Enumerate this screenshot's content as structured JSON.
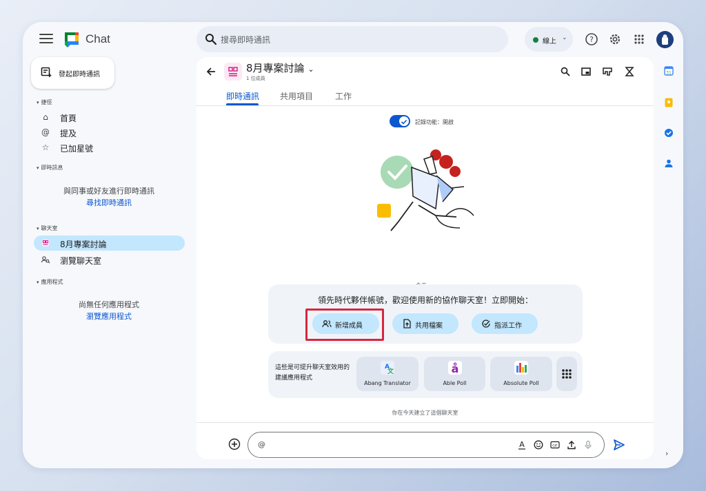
{
  "app": {
    "title": "Chat"
  },
  "search": {
    "placeholder": "搜尋即時通訊"
  },
  "status": {
    "label": "線上"
  },
  "sidebar": {
    "new_chat_label": "發起即時通訊",
    "shortcuts_header": "捷徑",
    "shortcuts": [
      {
        "label": "首頁",
        "icon": "home-icon"
      },
      {
        "label": "提及",
        "icon": "at-icon"
      },
      {
        "label": "已加星號",
        "icon": "star-icon"
      }
    ],
    "dm_header": "即時訊息",
    "dm_empty_text": "與同事或好友進行即時通訊",
    "dm_find_link": "尋找即時通訊",
    "spaces_header": "聊天室",
    "spaces": [
      {
        "label": "8月專案討論",
        "icon": "space-icon",
        "active": true
      },
      {
        "label": "瀏覽聊天室",
        "icon": "browse-spaces-icon",
        "active": false
      }
    ],
    "apps_header": "應用程式",
    "apps_empty_text": "尚無任何應用程式",
    "apps_browse_link": "瀏覽應用程式"
  },
  "room": {
    "title": "8月專案討論",
    "member_count": "1 位成員",
    "tabs": [
      "即時通訊",
      "共用項目",
      "工作"
    ]
  },
  "history": {
    "label": "記錄功能：開啟",
    "enabled": true
  },
  "today_label": "今天",
  "welcome": {
    "text": "領先時代夥伴帳號，歡迎使用新的協作聊天室！立即開始：",
    "actions": [
      "新增成員",
      "共用檔案",
      "指派工作"
    ]
  },
  "suggested_apps": {
    "text": "這些是可提升聊天室效用的建議應用程式",
    "apps": [
      "Abang Translator",
      "Able Poll",
      "Absolute Poll"
    ]
  },
  "created_note": "你在今天建立了這個聊天室",
  "composer": {
    "value": "@"
  },
  "colors": {
    "accent": "#0b57d0",
    "pill": "#c2e7ff",
    "highlight_box": "#d7263d",
    "online": "#188038"
  }
}
